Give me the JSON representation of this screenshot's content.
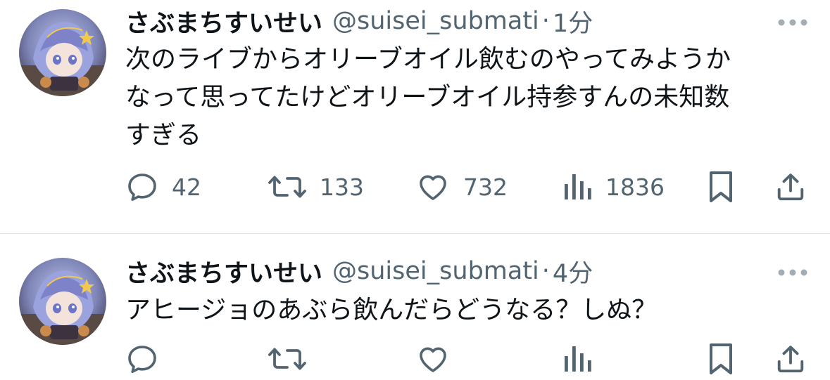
{
  "tweets": [
    {
      "display_name": "さぶまちすいせい",
      "handle": "@suisei_submati",
      "separator": "·",
      "time": "1分",
      "text": "次のライブからオリーブオイル飲むのやってみようか\nなって思ってたけどオリーブオイル持参すんの未知数\nすぎる",
      "replies": "42",
      "retweets": "133",
      "likes": "732",
      "views": "1836"
    },
    {
      "display_name": "さぶまちすいせい",
      "handle": "@suisei_submati",
      "separator": "·",
      "time": "4分",
      "text": "アヒージョのあぶら飲んだらどうなる？しぬ？"
    }
  ],
  "colors": {
    "text_primary": "#0f1419",
    "text_secondary": "#536471",
    "divider": "#dfe3e6"
  },
  "icons": [
    "reply-icon",
    "retweet-icon",
    "like-icon",
    "views-icon",
    "bookmark-icon",
    "share-icon",
    "more-icon"
  ]
}
